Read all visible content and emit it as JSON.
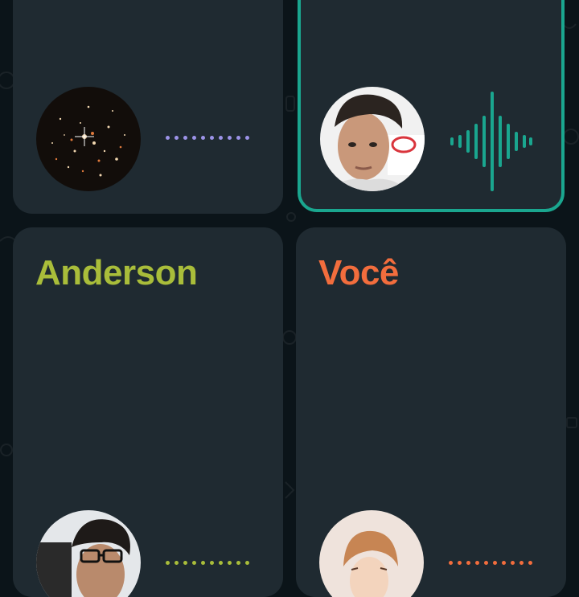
{
  "participants": [
    {
      "name": "",
      "accent": "#9c93e8",
      "avatar": "galaxy-photo",
      "speaking": false
    },
    {
      "name": "",
      "accent": "#1aa68f",
      "avatar": "boy-photo",
      "speaking": true
    },
    {
      "name": "Anderson",
      "accent": "#a9bd3a",
      "avatar": "glasses-photo",
      "speaking": false
    },
    {
      "name": "Você",
      "accent": "#f26d3d",
      "avatar": "anime-photo",
      "speaking": false
    }
  ],
  "colors": {
    "background": "#0b1419",
    "tile": "#1f2a31",
    "speaking_border": "#1aa68f"
  }
}
